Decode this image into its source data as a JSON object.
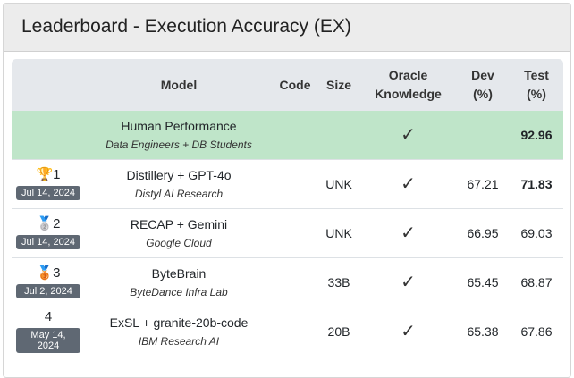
{
  "title": "Leaderboard - Execution Accuracy (EX)",
  "columns": {
    "model": "Model",
    "code": "Code",
    "size": "Size",
    "oracle1": "Oracle",
    "oracle2": "Knowledge",
    "dev1": "Dev",
    "dev2": "(%)",
    "test1": "Test",
    "test2": "(%)"
  },
  "human": {
    "name": "Human Performance",
    "org": "Data Engineers + DB Students",
    "oracle": "✓",
    "test": "92.96"
  },
  "rows": [
    {
      "rank": "1",
      "medal": "🏆",
      "date": "Jul 14, 2024",
      "name": "Distillery + GPT-4o",
      "org": "Distyl AI Research",
      "code": "",
      "size": "UNK",
      "oracle": "✓",
      "dev": "67.21",
      "test": "71.83"
    },
    {
      "rank": "2",
      "medal": "🥈",
      "date": "Jul 14, 2024",
      "name": "RECAP + Gemini",
      "org": "Google Cloud",
      "code": "",
      "size": "UNK",
      "oracle": "✓",
      "dev": "66.95",
      "test": "69.03"
    },
    {
      "rank": "3",
      "medal": "🥉",
      "date": "Jul 2, 2024",
      "name": "ByteBrain",
      "org": "ByteDance Infra Lab",
      "code": "",
      "size": "33B",
      "oracle": "✓",
      "dev": "65.45",
      "test": "68.87"
    },
    {
      "rank": "4",
      "medal": "",
      "date": "May 14, 2024",
      "name": "ExSL + granite-20b-code",
      "org": "IBM Research AI",
      "code": "",
      "size": "20B",
      "oracle": "✓",
      "dev": "65.38",
      "test": "67.86"
    }
  ]
}
